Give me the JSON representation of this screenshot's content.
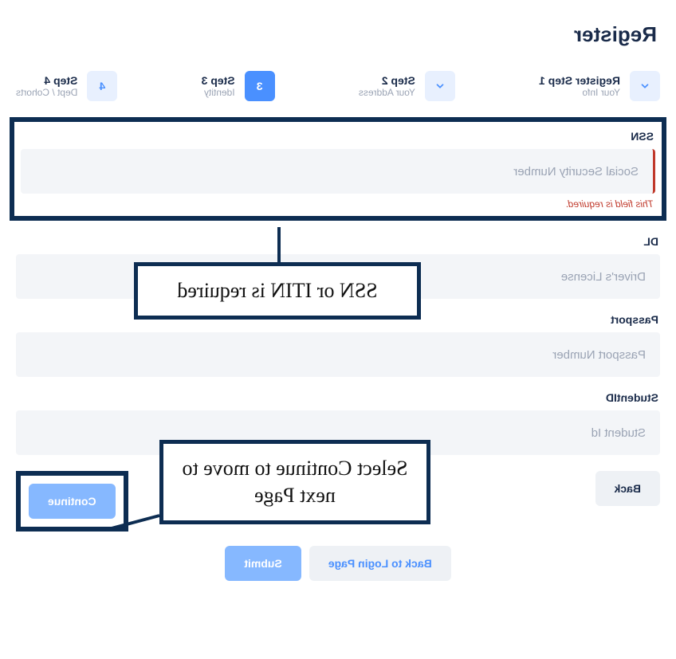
{
  "page_title": "Register",
  "stepper": [
    {
      "title": "Register Step 1",
      "sub": "Your Info",
      "state": "done"
    },
    {
      "title": "Step 2",
      "sub": "Your Address",
      "state": "done"
    },
    {
      "title": "Step 3",
      "sub": "Identity",
      "num": "3",
      "state": "active"
    },
    {
      "title": "Step 4",
      "sub": "Dept / Cohorts",
      "num": "4",
      "state": "upcoming"
    }
  ],
  "fields": {
    "ssn": {
      "label": "SSN",
      "placeholder": "Social Security Number",
      "error": "This field is required."
    },
    "dl": {
      "label": "DL",
      "placeholder": "Driver's License"
    },
    "passport": {
      "label": "Passport",
      "placeholder": "Passport Number"
    },
    "student": {
      "label": "StudentID",
      "placeholder": "Student Id"
    }
  },
  "buttons": {
    "back": "Back",
    "continue": "Continue",
    "login": "Back to Login Page",
    "submit": "Submit"
  },
  "callouts": {
    "c1": "SSN or ITIN is required",
    "c2": "Select Continue to move to next Page"
  }
}
